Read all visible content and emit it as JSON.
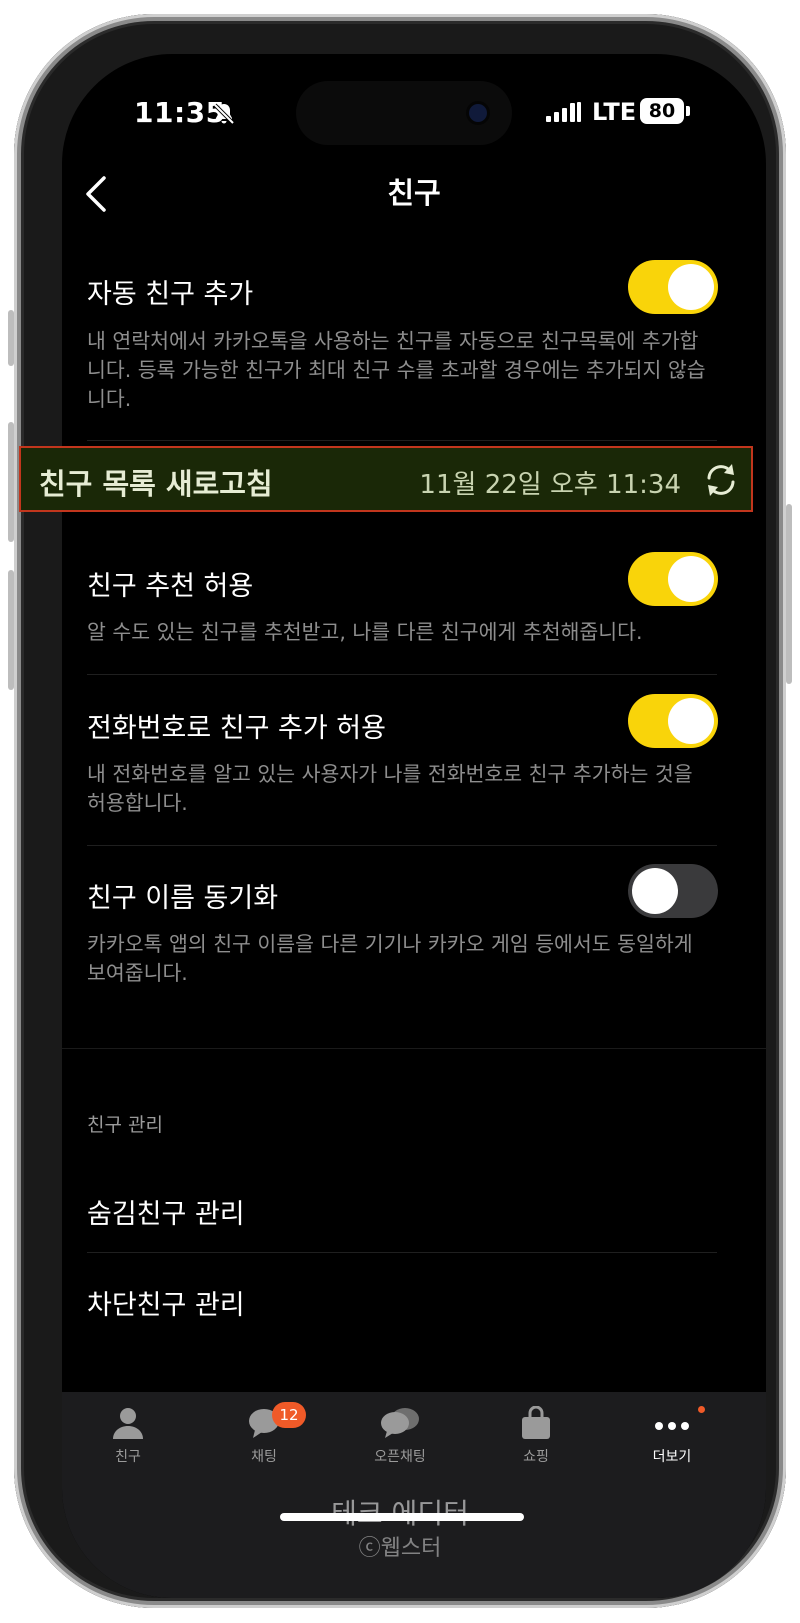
{
  "status_bar": {
    "time": "11:35",
    "network": "LTE",
    "battery": "80"
  },
  "header": {
    "title": "친구"
  },
  "settings": [
    {
      "title": "자동 친구 추가",
      "desc": "내 연락처에서 카카오톡을 사용하는 친구를 자동으로 친구목록에 추가합니다. 등록 가능한 친구가 최대 친구 수를 초과할 경우에는 추가되지 않습니다.",
      "toggle_on": true
    },
    {
      "title": "친구 추천 허용",
      "desc": "알 수도 있는 친구를 추천받고, 나를 다른 친구에게 추천해줍니다.",
      "toggle_on": true
    },
    {
      "title": "전화번호로 친구 추가 허용",
      "desc": "내 전화번호를 알고 있는 사용자가 나를 전화번호로 친구 추가하는 것을 허용합니다.",
      "toggle_on": true
    },
    {
      "title": "친구 이름 동기화",
      "desc": "카카오톡 앱의 친구 이름을 다른 기기나 카카오 게임 등에서도 동일하게 보여줍니다.",
      "toggle_on": false
    }
  ],
  "refresh": {
    "label": "친구 목록 새로고침",
    "time": "11월 22일 오후 11:34"
  },
  "manage": {
    "section_label": "친구 관리",
    "hidden": "숨김친구 관리",
    "blocked": "차단친구 관리"
  },
  "tabs": [
    {
      "label": "친구",
      "icon": "person-icon"
    },
    {
      "label": "채팅",
      "icon": "chat-bubble-icon",
      "badge": "12"
    },
    {
      "label": "오픈채팅",
      "icon": "open-chat-icon"
    },
    {
      "label": "쇼핑",
      "icon": "shopping-bag-icon"
    },
    {
      "label": "더보기",
      "icon": "more-dots-icon",
      "active": true
    }
  ],
  "watermark": {
    "line1": "테크 에디터",
    "line2": "ⓒ웹스터"
  },
  "colors": {
    "toggle_on": "#f9d40a",
    "badge": "#f05a28",
    "highlight_border": "#c2361d"
  }
}
